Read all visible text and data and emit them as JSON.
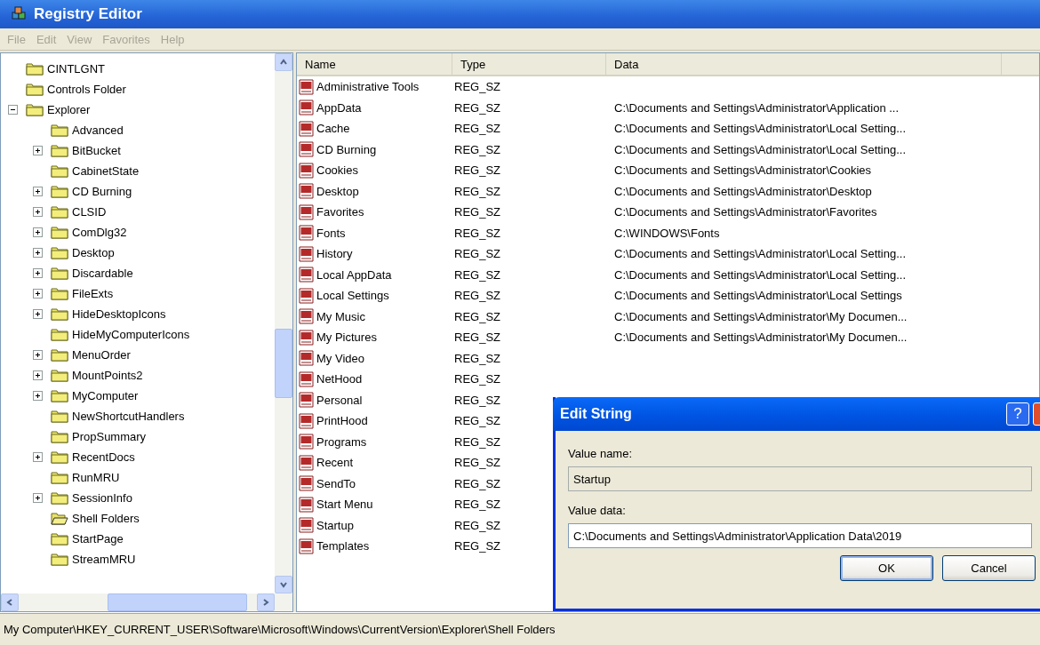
{
  "window": {
    "title": "Registry Editor"
  },
  "menu": [
    {
      "label": "File",
      "disabled": true
    },
    {
      "label": "Edit",
      "disabled": true
    },
    {
      "label": "View",
      "disabled": true
    },
    {
      "label": "Favorites",
      "disabled": true
    },
    {
      "label": "Help",
      "disabled": true
    }
  ],
  "tree": [
    {
      "label": "CINTLGNT",
      "selected": false
    },
    {
      "label": "Controls Folder",
      "selected": false
    },
    {
      "label": "Explorer",
      "expanded": true,
      "selected": false,
      "children": [
        {
          "label": "Advanced",
          "selected": false
        },
        {
          "label": "BitBucket",
          "expanded": false,
          "selected": false
        },
        {
          "label": "CabinetState",
          "selected": false
        },
        {
          "label": "CD Burning",
          "expanded": false,
          "selected": false
        },
        {
          "label": "CLSID",
          "expanded": false,
          "selected": false
        },
        {
          "label": "ComDlg32",
          "expanded": false,
          "selected": false
        },
        {
          "label": "Desktop",
          "expanded": false,
          "selected": false
        },
        {
          "label": "Discardable",
          "expanded": false,
          "selected": false
        },
        {
          "label": "FileExts",
          "expanded": false,
          "selected": false
        },
        {
          "label": "HideDesktopIcons",
          "expanded": false,
          "selected": false
        },
        {
          "label": "HideMyComputerIcons",
          "selected": false
        },
        {
          "label": "MenuOrder",
          "expanded": false,
          "selected": false
        },
        {
          "label": "MountPoints2",
          "expanded": false,
          "selected": false
        },
        {
          "label": "MyComputer",
          "expanded": false,
          "selected": false
        },
        {
          "label": "NewShortcutHandlers",
          "selected": false
        },
        {
          "label": "PropSummary",
          "selected": false
        },
        {
          "label": "RecentDocs",
          "expanded": false,
          "selected": false
        },
        {
          "label": "RunMRU",
          "selected": false
        },
        {
          "label": "SessionInfo",
          "expanded": false,
          "selected": false
        },
        {
          "label": "Shell Folders",
          "selected": true
        },
        {
          "label": "StartPage",
          "selected": false
        },
        {
          "label": "StreamMRU",
          "selected": false
        }
      ]
    }
  ],
  "table": {
    "columns": [
      "Name",
      "Type",
      "Data"
    ],
    "rows": [
      {
        "name": "Administrative Tools",
        "type": "REG_SZ"
      },
      {
        "name": "AppData",
        "type": "REG_SZ",
        "data": "C:\\Documents and Settings\\Administrator\\Application ..."
      },
      {
        "name": "Cache",
        "type": "REG_SZ",
        "data": "C:\\Documents and Settings\\Administrator\\Local Setting..."
      },
      {
        "name": "CD Burning",
        "type": "REG_SZ",
        "data": "C:\\Documents and Settings\\Administrator\\Local Setting..."
      },
      {
        "name": "Cookies",
        "type": "REG_SZ",
        "data": "C:\\Documents and Settings\\Administrator\\Cookies"
      },
      {
        "name": "Desktop",
        "type": "REG_SZ",
        "data": "C:\\Documents and Settings\\Administrator\\Desktop"
      },
      {
        "name": "Favorites",
        "type": "REG_SZ",
        "data": "C:\\Documents and Settings\\Administrator\\Favorites"
      },
      {
        "name": "Fonts",
        "type": "REG_SZ",
        "data": "C:\\WINDOWS\\Fonts"
      },
      {
        "name": "History",
        "type": "REG_SZ",
        "data": "C:\\Documents and Settings\\Administrator\\Local Setting..."
      },
      {
        "name": "Local AppData",
        "type": "REG_SZ",
        "data": "C:\\Documents and Settings\\Administrator\\Local Setting..."
      },
      {
        "name": "Local Settings",
        "type": "REG_SZ",
        "data": "C:\\Documents and Settings\\Administrator\\Local Settings"
      },
      {
        "name": "My Music",
        "type": "REG_SZ",
        "data": "C:\\Documents and Settings\\Administrator\\My Documen..."
      },
      {
        "name": "My Pictures",
        "type": "REG_SZ",
        "data": "C:\\Documents and Settings\\Administrator\\My Documen..."
      },
      {
        "name": "My Video",
        "type": "REG_SZ"
      },
      {
        "name": "NetHood",
        "type": "REG_SZ"
      },
      {
        "name": "Personal",
        "type": "REG_SZ"
      },
      {
        "name": "PrintHood",
        "type": "REG_SZ"
      },
      {
        "name": "Programs",
        "type": "REG_SZ"
      },
      {
        "name": "Recent",
        "type": "REG_SZ"
      },
      {
        "name": "SendTo",
        "type": "REG_SZ"
      },
      {
        "name": "Start Menu",
        "type": "REG_SZ"
      },
      {
        "name": "Startup",
        "type": "REG_SZ"
      },
      {
        "name": "Templates",
        "type": "REG_SZ"
      }
    ]
  },
  "status_bar": "My Computer\\HKEY_CURRENT_USER\\Software\\Microsoft\\Windows\\CurrentVersion\\Explorer\\Shell Folders",
  "dialog": {
    "title": "Edit String",
    "help_button": "?",
    "name_label": "Value name:",
    "name_value": "Startup",
    "data_label": "Value data:",
    "data_value": "C:\\Documents and Settings\\Administrator\\Application Data\\2019",
    "buttons": [
      "OK",
      "Cancel"
    ]
  }
}
